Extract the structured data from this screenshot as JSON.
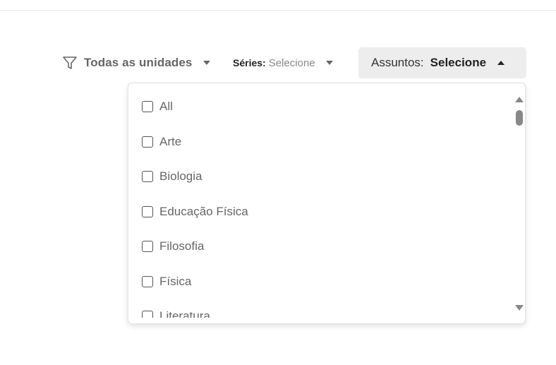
{
  "filters": {
    "units": {
      "label": "Todas as unidades",
      "icon": "filter-icon"
    },
    "series": {
      "prefix": "Séries:",
      "value": "Selecione"
    },
    "subjects": {
      "prefix": "Assuntos:",
      "value": "Selecione",
      "expanded": true
    }
  },
  "dropdown": {
    "options": [
      {
        "label": "All",
        "checked": false
      },
      {
        "label": "Arte",
        "checked": false
      },
      {
        "label": "Biologia",
        "checked": false
      },
      {
        "label": "Educação Física",
        "checked": false
      },
      {
        "label": "Filosofia",
        "checked": false
      },
      {
        "label": "Física",
        "checked": false
      },
      {
        "label": "Literatura",
        "checked": false
      }
    ]
  },
  "colors": {
    "subjects_button_bg": "#ededed",
    "text_muted": "#666666",
    "scrollbar": "#888888"
  }
}
